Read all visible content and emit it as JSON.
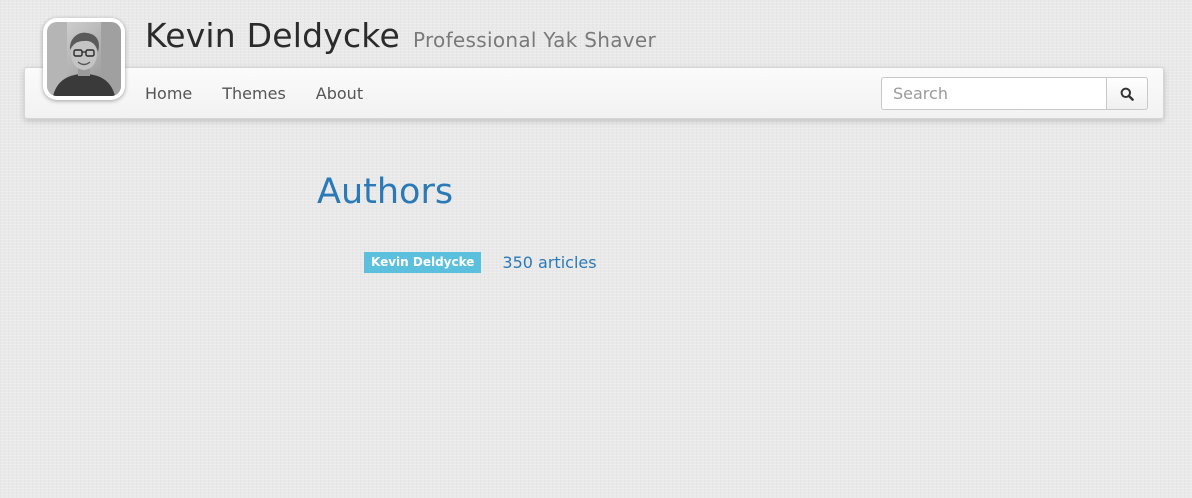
{
  "site": {
    "title": "Kevin Deldycke",
    "tagline": "Professional Yak Shaver"
  },
  "nav": {
    "items": [
      {
        "label": "Home"
      },
      {
        "label": "Themes"
      },
      {
        "label": "About"
      }
    ]
  },
  "search": {
    "placeholder": "Search",
    "value": "",
    "button_icon": "search-icon"
  },
  "main": {
    "heading": "Authors",
    "authors": [
      {
        "name": "Kevin Deldycke",
        "count_label": "350 articles"
      }
    ]
  },
  "colors": {
    "link": "#2a7ab8",
    "badge": "#5bc0de"
  }
}
